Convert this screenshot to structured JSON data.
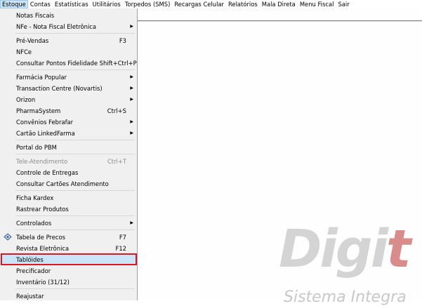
{
  "menubar": [
    {
      "label": "Estoque",
      "active": true
    },
    {
      "label": "Contas"
    },
    {
      "label": "Estatísticas"
    },
    {
      "label": "Utilitários"
    },
    {
      "label": "Torpedos (SMS)"
    },
    {
      "label": "Recargas Celular"
    },
    {
      "label": "Relatórios"
    },
    {
      "label": "Mala Direta"
    },
    {
      "label": "Menu Fiscal"
    },
    {
      "label": "Sair"
    }
  ],
  "dropdown": {
    "notas_fiscais": "Notas Fiscais",
    "nfe": "NFe - Nota Fiscal Eletrônica",
    "pre_vendas": "Pré-Vendas",
    "pre_vendas_shortcut": "F3",
    "nfce": "NFCe",
    "consultar_pontos": "Consultar Pontos Fidelidade Shift+Ctrl+P",
    "farmacia_popular": "Farmácia Popular",
    "transaction_centre": "Transaction Centre (Novartis)",
    "orizon": "Orizon",
    "pharmasystem": "PharmaSystem",
    "pharmasystem_shortcut": "Ctrl+S",
    "convenios_febrafar": "Convênios Febrafar",
    "cartao_linkedfarma": "Cartão LinkedFarma",
    "portal_pbm": "Portal do PBM",
    "tele_atendimento": "Tele-Atendimento",
    "tele_atendimento_shortcut": "Ctrl+T",
    "controle_entregas": "Controle de Entregas",
    "consultar_cartoes": "Consultar Cartões Atendimento",
    "ficha_kardex": "Ficha Kardex",
    "rastrear_produtos": "Rastrear Produtos",
    "controlados": "Controlados",
    "tabela_precos": "Tabela de Precos",
    "tabela_precos_shortcut": "F7",
    "revista_eletronica": "Revista Eletrônica",
    "revista_eletronica_shortcut": "F12",
    "tabloides": "Tablóides",
    "precificador": "Precificador",
    "inventario": "Inventário (31/12)",
    "reajustar": "Reajustar"
  },
  "background": {
    "logo_text": "Digi",
    "logo_accent": "t",
    "subtitle": "Sistema Integra"
  }
}
